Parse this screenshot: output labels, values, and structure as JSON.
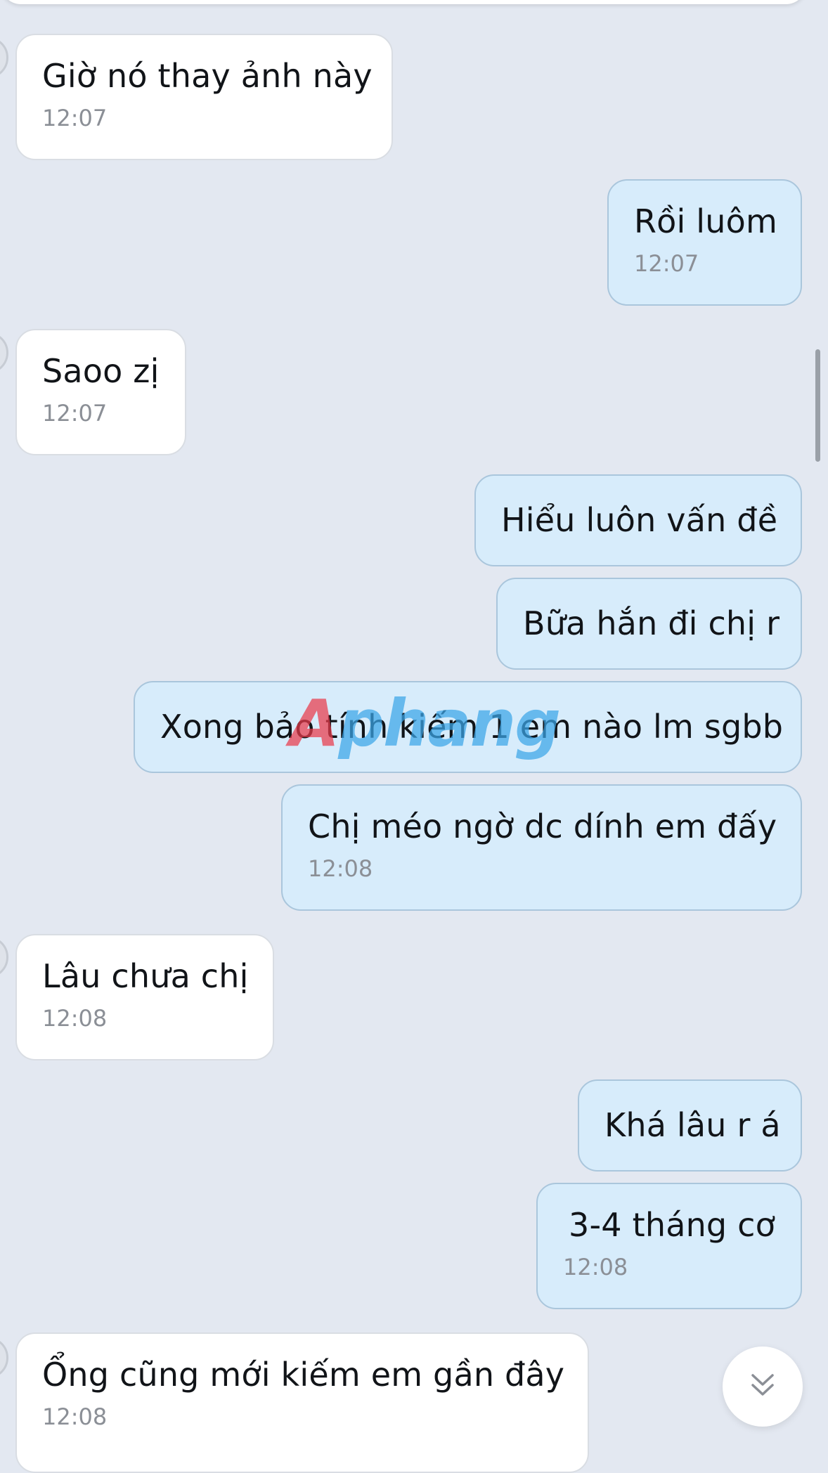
{
  "messages": [
    {
      "direction": "in",
      "text": "Giờ nó thay ảnh này",
      "time": "12:07"
    },
    {
      "direction": "out",
      "text": "Rồi luôm",
      "time": "12:07"
    },
    {
      "direction": "in",
      "text": "Saoo zị",
      "time": "12:07"
    },
    {
      "direction": "out",
      "text": "Hiểu luôn vấn đề",
      "time": ""
    },
    {
      "direction": "out",
      "text": "Bữa hắn đi chị r",
      "time": ""
    },
    {
      "direction": "out",
      "text": "Xong bảo tính kiếm 1 em nào lm sgbb",
      "time": ""
    },
    {
      "direction": "out",
      "text": "Chị méo ngờ dc dính em đấy",
      "time": "12:08"
    },
    {
      "direction": "in",
      "text": "Lâu chưa chị",
      "time": "12:08"
    },
    {
      "direction": "out",
      "text": "Khá lâu r á",
      "time": ""
    },
    {
      "direction": "out",
      "text": "3-4 tháng cơ",
      "time": "12:08"
    },
    {
      "direction": "in",
      "text": "Ổng cũng mới kiếm em gần đây",
      "time": "12:08"
    }
  ],
  "watermark": {
    "first": "A",
    "rest": "phang"
  },
  "icons": {
    "scroll_down": "chevron-double-down-icon",
    "avatar": "avatar-icon"
  },
  "colors": {
    "background": "#e3e8f1",
    "incoming_bubble": "#ffffff",
    "outgoing_bubble": "#d7ecfb",
    "timestamp": "#8b8f96"
  }
}
